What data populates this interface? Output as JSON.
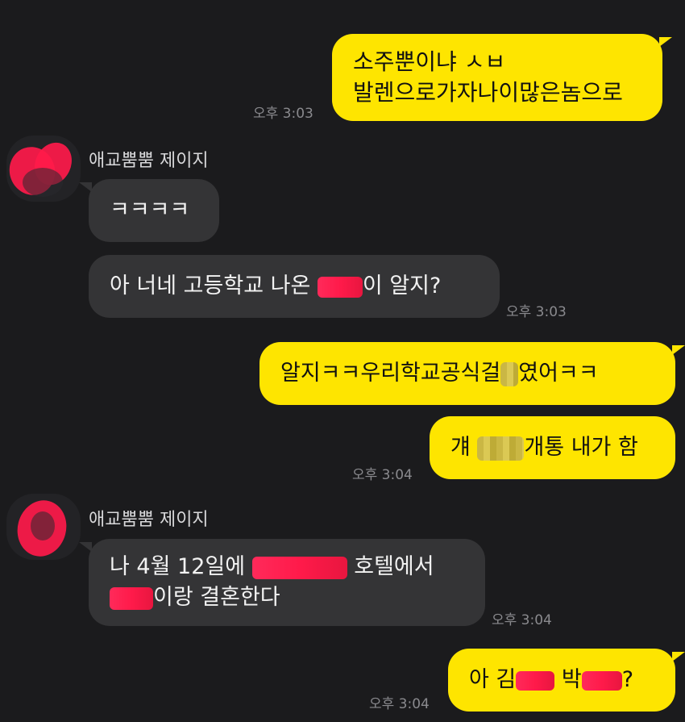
{
  "messages": [
    {
      "id": "m1",
      "side": "mine",
      "lines": [
        "소주뿐이냐 ㅅㅂ",
        "발렌으로가자나이많은놈으로"
      ],
      "time": "오후 3:03"
    },
    {
      "id": "m2",
      "side": "theirs",
      "sender": "애교뿜뿜 제이지",
      "text": "ㅋㅋㅋㅋ"
    },
    {
      "id": "m3",
      "side": "theirs",
      "text_before": "아 너네 고등학교 나온 ",
      "text_after": "이 알지?",
      "time": "오후 3:03"
    },
    {
      "id": "m4",
      "side": "mine",
      "text_before": "알지ㅋㅋ우리학교공식걸",
      "text_after": "였어ㅋㅋ"
    },
    {
      "id": "m5",
      "side": "mine",
      "text_before": "걔 ",
      "text_after": "개통 내가 함",
      "time": "오후 3:04"
    },
    {
      "id": "m6",
      "side": "theirs",
      "sender": "애교뿜뿜 제이지",
      "line1_before": "나 4월 12일에 ",
      "line1_after": " 호텔에서",
      "line2_after": "이랑 결혼한다",
      "time": "오후 3:04"
    },
    {
      "id": "m7",
      "side": "mine",
      "text_a": "아 김",
      "text_b": " 박",
      "text_c": "?",
      "time": "오후 3:04"
    }
  ],
  "colors": {
    "background": "#1b1b1d",
    "my_bubble": "#fee500",
    "their_bubble": "#343436",
    "timestamp": "#8a8a8e",
    "censor_red": "#ff1a4a"
  }
}
